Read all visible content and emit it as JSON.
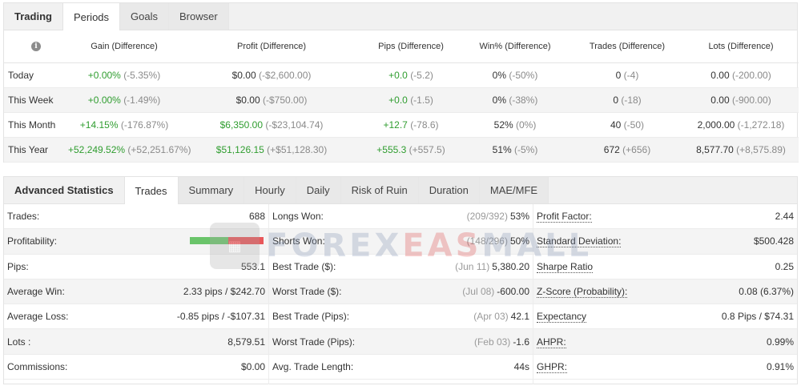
{
  "periods_panel": {
    "tabs": [
      {
        "label": "Trading",
        "active": false,
        "title": true
      },
      {
        "label": "Periods",
        "active": true
      },
      {
        "label": "Goals",
        "active": false
      },
      {
        "label": "Browser",
        "active": false
      }
    ],
    "columns": [
      "Gain (Difference)",
      "Profit (Difference)",
      "Pips (Difference)",
      "Win% (Difference)",
      "Trades (Difference)",
      "Lots (Difference)"
    ],
    "rows": [
      {
        "label": "Today",
        "cells": [
          {
            "v": "+0.00%",
            "d": "(-5.35%)",
            "pos": true
          },
          {
            "v": "$0.00",
            "d": "(-$2,600.00)",
            "pos": false
          },
          {
            "v": "+0.0",
            "d": "(-5.2)",
            "pos": true
          },
          {
            "v": "0%",
            "d": "(-50%)",
            "pos": false
          },
          {
            "v": "0",
            "d": "(-4)",
            "pos": false
          },
          {
            "v": "0.00",
            "d": "(-200.00)",
            "pos": false
          }
        ]
      },
      {
        "label": "This Week",
        "cells": [
          {
            "v": "+0.00%",
            "d": "(-1.49%)",
            "pos": true
          },
          {
            "v": "$0.00",
            "d": "(-$750.00)",
            "pos": false
          },
          {
            "v": "+0.0",
            "d": "(-1.5)",
            "pos": true
          },
          {
            "v": "0%",
            "d": "(-38%)",
            "pos": false
          },
          {
            "v": "0",
            "d": "(-18)",
            "pos": false
          },
          {
            "v": "0.00",
            "d": "(-900.00)",
            "pos": false
          }
        ]
      },
      {
        "label": "This Month",
        "cells": [
          {
            "v": "+14.15%",
            "d": "(-176.87%)",
            "pos": true
          },
          {
            "v": "$6,350.00",
            "d": "(-$23,104.74)",
            "pos": true
          },
          {
            "v": "+12.7",
            "d": "(-78.6)",
            "pos": true
          },
          {
            "v": "52%",
            "d": "(0%)",
            "pos": false
          },
          {
            "v": "40",
            "d": "(-50)",
            "pos": false
          },
          {
            "v": "2,000.00",
            "d": "(-1,272.18)",
            "pos": false
          }
        ]
      },
      {
        "label": "This Year",
        "cells": [
          {
            "v": "+52,249.52%",
            "d": "(+52,251.67%)",
            "pos": true
          },
          {
            "v": "$51,126.15",
            "d": "(+$51,128.30)",
            "pos": true
          },
          {
            "v": "+555.3",
            "d": "(+557.5)",
            "pos": true
          },
          {
            "v": "51%",
            "d": "(-5%)",
            "pos": false
          },
          {
            "v": "672",
            "d": "(+656)",
            "pos": false
          },
          {
            "v": "8,577.70",
            "d": "(+8,575.89)",
            "pos": false
          }
        ]
      }
    ]
  },
  "advanced_panel": {
    "tabs": [
      {
        "label": "Advanced Statistics",
        "title": true
      },
      {
        "label": "Trades",
        "active": true
      },
      {
        "label": "Summary"
      },
      {
        "label": "Hourly"
      },
      {
        "label": "Daily"
      },
      {
        "label": "Risk of Ruin"
      },
      {
        "label": "Duration"
      },
      {
        "label": "MAE/MFE"
      }
    ],
    "col1": [
      {
        "label": "Trades:",
        "value": "688"
      },
      {
        "label": "Profitability:",
        "value": "",
        "bar": true
      },
      {
        "label": "Pips:",
        "value": "553.1"
      },
      {
        "label": "Average Win:",
        "value": "2.33 pips / $242.70"
      },
      {
        "label": "Average Loss:",
        "value": "-0.85 pips / -$107.31"
      },
      {
        "label": "Lots :",
        "value": "8,579.51"
      },
      {
        "label": "Commissions:",
        "value": "$0.00"
      }
    ],
    "profitability": {
      "win_fraction": 0.52,
      "win_color": "#6ac46a",
      "loss_color": "#e8575a"
    },
    "col2": [
      {
        "label": "Longs Won:",
        "sub": "(209/392)",
        "value": "53%"
      },
      {
        "label": "Shorts Won:",
        "sub": "(148/296)",
        "value": "50%"
      },
      {
        "label": "Best Trade ($):",
        "sub": "(Jun 11)",
        "value": "5,380.20"
      },
      {
        "label": "Worst Trade ($):",
        "sub": "(Jul 08)",
        "value": "-600.00"
      },
      {
        "label": "Best Trade (Pips):",
        "sub": "(Apr 03)",
        "value": "42.1"
      },
      {
        "label": "Worst Trade (Pips):",
        "sub": "(Feb 03)",
        "value": "-1.6"
      },
      {
        "label": "Avg. Trade Length:",
        "sub": "",
        "value": "44s"
      }
    ],
    "col3": [
      {
        "label": "Profit Factor:",
        "value": "2.44"
      },
      {
        "label": "Standard Deviation:",
        "value": "$500.428"
      },
      {
        "label": "Sharpe Ratio",
        "value": "0.25"
      },
      {
        "label": "Z-Score (Probability):",
        "value": "0.08 (6.37%)"
      },
      {
        "label": "Expectancy",
        "value": "0.8 Pips / $74.31"
      },
      {
        "label": "AHPR:",
        "value": "0.99%"
      },
      {
        "label": "GHPR:",
        "value": "0.91%"
      }
    ]
  },
  "watermark": {
    "text_a": "FOREX",
    "text_b": "EAS",
    "text_c": "MALL"
  },
  "icons": {
    "info": "info-icon"
  }
}
